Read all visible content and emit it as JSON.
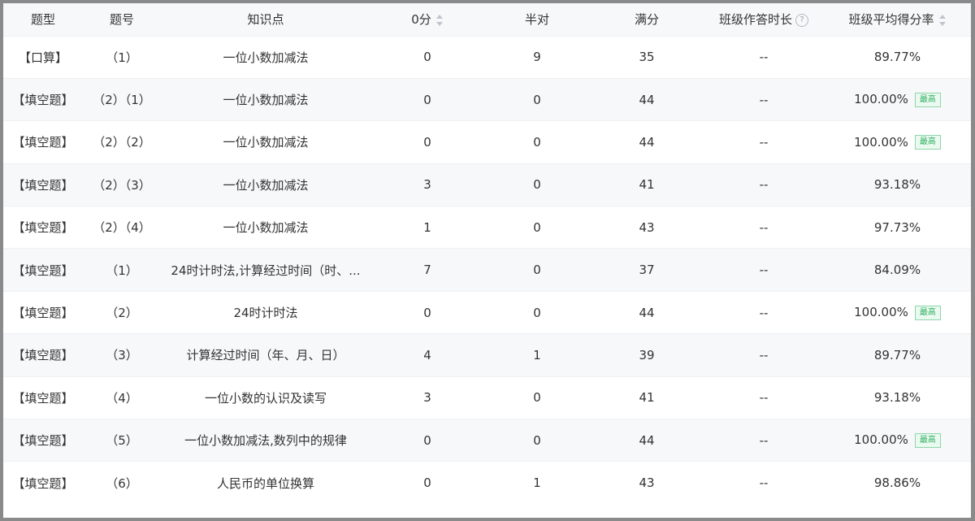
{
  "table": {
    "headers": {
      "type": "题型",
      "number": "题号",
      "knowledge": "知识点",
      "zero": "0分",
      "half": "半对",
      "full": "满分",
      "duration": "班级作答时长",
      "avg": "班级平均得分率"
    },
    "help_glyph": "?",
    "rows": [
      {
        "type": "【口算】",
        "number": "（1）",
        "knowledge": "一位小数加减法",
        "zero": "0",
        "half": "9",
        "full": "35",
        "duration": "--",
        "avg": "89.77%",
        "badge": ""
      },
      {
        "type": "【填空题】",
        "number": "（2）（1）",
        "knowledge": "一位小数加减法",
        "zero": "0",
        "half": "0",
        "full": "44",
        "duration": "--",
        "avg": "100.00%",
        "badge": "最高"
      },
      {
        "type": "【填空题】",
        "number": "（2）（2）",
        "knowledge": "一位小数加减法",
        "zero": "0",
        "half": "0",
        "full": "44",
        "duration": "--",
        "avg": "100.00%",
        "badge": "最高"
      },
      {
        "type": "【填空题】",
        "number": "（2）（3）",
        "knowledge": "一位小数加减法",
        "zero": "3",
        "half": "0",
        "full": "41",
        "duration": "--",
        "avg": "93.18%",
        "badge": ""
      },
      {
        "type": "【填空题】",
        "number": "（2）（4）",
        "knowledge": "一位小数加减法",
        "zero": "1",
        "half": "0",
        "full": "43",
        "duration": "--",
        "avg": "97.73%",
        "badge": ""
      },
      {
        "type": "【填空题】",
        "number": "（1）",
        "knowledge": "24时计时法,计算经过时间（时、...",
        "zero": "7",
        "half": "0",
        "full": "37",
        "duration": "--",
        "avg": "84.09%",
        "badge": ""
      },
      {
        "type": "【填空题】",
        "number": "（2）",
        "knowledge": "24时计时法",
        "zero": "0",
        "half": "0",
        "full": "44",
        "duration": "--",
        "avg": "100.00%",
        "badge": "最高"
      },
      {
        "type": "【填空题】",
        "number": "（3）",
        "knowledge": "计算经过时间（年、月、日）",
        "zero": "4",
        "half": "1",
        "full": "39",
        "duration": "--",
        "avg": "89.77%",
        "badge": ""
      },
      {
        "type": "【填空题】",
        "number": "（4）",
        "knowledge": "一位小数的认识及读写",
        "zero": "3",
        "half": "0",
        "full": "41",
        "duration": "--",
        "avg": "93.18%",
        "badge": ""
      },
      {
        "type": "【填空题】",
        "number": "（5）",
        "knowledge": "一位小数加减法,数列中的规律",
        "zero": "0",
        "half": "0",
        "full": "44",
        "duration": "--",
        "avg": "100.00%",
        "badge": "最高"
      },
      {
        "type": "【填空题】",
        "number": "（6）",
        "knowledge": "人民币的单位换算",
        "zero": "0",
        "half": "1",
        "full": "43",
        "duration": "--",
        "avg": "98.86%",
        "badge": ""
      }
    ]
  },
  "colors": {
    "header_bg": "#f7f8fa",
    "stripe_bg": "#f7f8fa",
    "badge_text": "#2fae60",
    "badge_border": "#8fd6a9"
  },
  "icons": {
    "zero_sort": "sort-icon",
    "avg_sort": "sort-icon",
    "duration_help": "question-circle-icon"
  }
}
